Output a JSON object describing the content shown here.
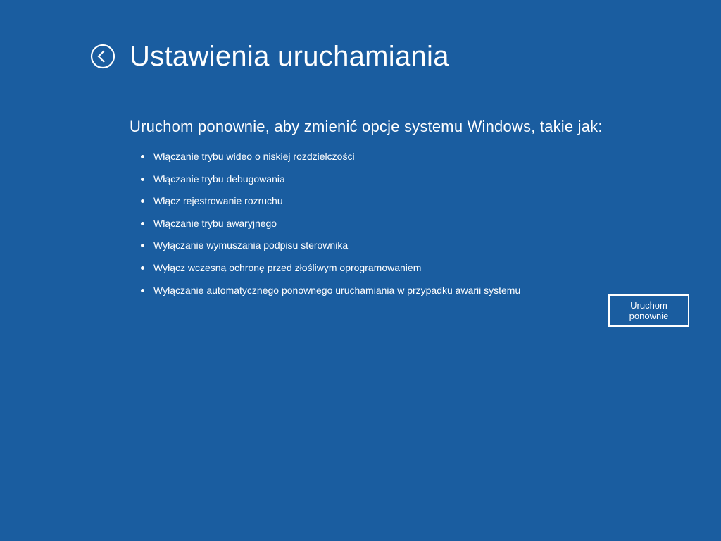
{
  "title": "Ustawienia uruchamiania",
  "subtitle": "Uruchom ponownie, aby zmienić opcje systemu Windows, takie jak:",
  "options": [
    "Włączanie trybu wideo o niskiej rozdzielczości",
    "Włączanie trybu debugowania",
    "Włącz rejestrowanie rozruchu",
    "Włączanie trybu awaryjnego",
    "Wyłączanie wymuszania podpisu sterownika",
    "Wyłącz wczesną ochronę przed złośliwym oprogramowaniem",
    "Wyłączanie automatycznego ponownego uruchamiania w przypadku awarii systemu"
  ],
  "restart_label": "Uruchom ponownie"
}
